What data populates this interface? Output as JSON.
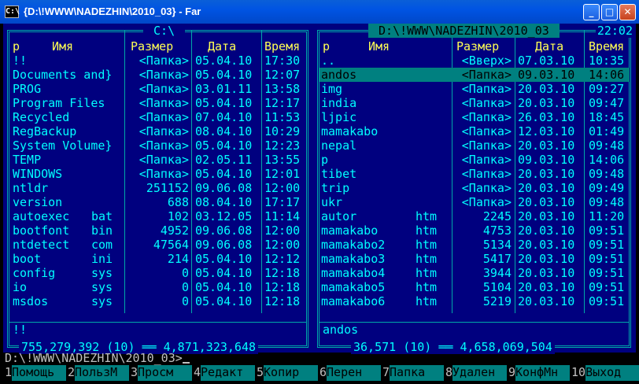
{
  "window": {
    "title": "{D:\\!WWW\\NADEZHIN\\2010_03} - Far",
    "app_icon": "C:\\",
    "buttons": [
      "_",
      "□",
      "✕"
    ]
  },
  "left_panel": {
    "title": " C:\\ ",
    "headers": {
      "p": "p",
      "name": "Имя",
      "size": "Размер",
      "date": "Дата",
      "time": "Время"
    },
    "rows": [
      {
        "name": "!!",
        "ext": "",
        "size": "<Папка>",
        "date": "05.04.10",
        "time": "17:30"
      },
      {
        "name": "Documents and}",
        "ext": "",
        "size": "<Папка>",
        "date": "05.04.10",
        "time": "12:07"
      },
      {
        "name": "PROG",
        "ext": "",
        "size": "<Папка>",
        "date": "03.01.11",
        "time": "13:58"
      },
      {
        "name": "Program Files",
        "ext": "",
        "size": "<Папка>",
        "date": "05.04.10",
        "time": "12:17"
      },
      {
        "name": "Recycled",
        "ext": "",
        "size": "<Папка>",
        "date": "07.04.10",
        "time": "11:53"
      },
      {
        "name": "RegBackup",
        "ext": "",
        "size": "<Папка>",
        "date": "08.04.10",
        "time": "10:29"
      },
      {
        "name": "System Volume}",
        "ext": "",
        "size": "<Папка>",
        "date": "05.04.10",
        "time": "12:23"
      },
      {
        "name": "TEMP",
        "ext": "",
        "size": "<Папка>",
        "date": "02.05.11",
        "time": "13:55"
      },
      {
        "name": "WINDOWS",
        "ext": "",
        "size": "<Папка>",
        "date": "05.04.10",
        "time": "12:01"
      },
      {
        "name": "ntldr",
        "ext": "",
        "size": "251152",
        "date": "09.06.08",
        "time": "12:00"
      },
      {
        "name": "version",
        "ext": "",
        "size": "688",
        "date": "08.04.10",
        "time": "17:17"
      },
      {
        "name": "autoexec",
        "ext": "bat",
        "size": "102",
        "date": "03.12.05",
        "time": "11:14"
      },
      {
        "name": "bootfont",
        "ext": "bin",
        "size": "4952",
        "date": "09.06.08",
        "time": "12:00"
      },
      {
        "name": "ntdetect",
        "ext": "com",
        "size": "47564",
        "date": "09.06.08",
        "time": "12:00"
      },
      {
        "name": "boot",
        "ext": "ini",
        "size": "214",
        "date": "05.04.10",
        "time": "12:12"
      },
      {
        "name": "config",
        "ext": "sys",
        "size": "0",
        "date": "05.04.10",
        "time": "12:18"
      },
      {
        "name": "io",
        "ext": "sys",
        "size": "0",
        "date": "05.04.10",
        "time": "12:18"
      },
      {
        "name": "msdos",
        "ext": "sys",
        "size": "0",
        "date": "05.04.10",
        "time": "12:18"
      }
    ],
    "current_file": "!!",
    "status": "755,279,392 (10) ══ 4,871,323,648"
  },
  "right_panel": {
    "title": " D:\\!WWW\\NADEZHIN\\2010_03 ",
    "clock": "22:02",
    "headers": {
      "p": "p",
      "name": "Имя",
      "size": "Размер",
      "date": "Дата",
      "time": "Время"
    },
    "rows": [
      {
        "name": "..",
        "ext": "",
        "size": "<Вверх>",
        "date": "07.03.10",
        "time": "10:35",
        "selected": false
      },
      {
        "name": "andos",
        "ext": "",
        "size": "<Папка>",
        "date": "09.03.10",
        "time": "14:06",
        "selected": true
      },
      {
        "name": "img",
        "ext": "",
        "size": "<Папка>",
        "date": "20.03.10",
        "time": "09:27",
        "selected": false
      },
      {
        "name": "india",
        "ext": "",
        "size": "<Папка>",
        "date": "20.03.10",
        "time": "09:47",
        "selected": false
      },
      {
        "name": "ljpic",
        "ext": "",
        "size": "<Папка>",
        "date": "26.03.10",
        "time": "18:45",
        "selected": false
      },
      {
        "name": "mamakabo",
        "ext": "",
        "size": "<Папка>",
        "date": "12.03.10",
        "time": "01:49",
        "selected": false
      },
      {
        "name": "nepal",
        "ext": "",
        "size": "<Папка>",
        "date": "20.03.10",
        "time": "09:48",
        "selected": false
      },
      {
        "name": "p",
        "ext": "",
        "size": "<Папка>",
        "date": "09.03.10",
        "time": "14:06",
        "selected": false
      },
      {
        "name": "tibet",
        "ext": "",
        "size": "<Папка>",
        "date": "20.03.10",
        "time": "09:48",
        "selected": false
      },
      {
        "name": "trip",
        "ext": "",
        "size": "<Папка>",
        "date": "20.03.10",
        "time": "09:49",
        "selected": false
      },
      {
        "name": "ukr",
        "ext": "",
        "size": "<Папка>",
        "date": "20.03.10",
        "time": "09:48",
        "selected": false
      },
      {
        "name": "autor",
        "ext": "htm",
        "size": "2245",
        "date": "20.03.10",
        "time": "11:20",
        "selected": false
      },
      {
        "name": "mamakabo",
        "ext": "htm",
        "size": "4753",
        "date": "20.03.10",
        "time": "09:51",
        "selected": false
      },
      {
        "name": "mamakabo2",
        "ext": "htm",
        "size": "5134",
        "date": "20.03.10",
        "time": "09:51",
        "selected": false
      },
      {
        "name": "mamakabo3",
        "ext": "htm",
        "size": "5417",
        "date": "20.03.10",
        "time": "09:51",
        "selected": false
      },
      {
        "name": "mamakabo4",
        "ext": "htm",
        "size": "3944",
        "date": "20.03.10",
        "time": "09:51",
        "selected": false
      },
      {
        "name": "mamakabo5",
        "ext": "htm",
        "size": "5104",
        "date": "20.03.10",
        "time": "09:51",
        "selected": false
      },
      {
        "name": "mamakabo6",
        "ext": "htm",
        "size": "5219",
        "date": "20.03.10",
        "time": "09:51",
        "selected": false
      }
    ],
    "current_file": "andos",
    "status": "36,571 (10) ══ 4,658,069,504"
  },
  "command_line": {
    "prompt": "D:\\!WWW\\NADEZHIN\\2010_03>"
  },
  "keybar": [
    {
      "num": "1",
      "label": "Помощь"
    },
    {
      "num": "2",
      "label": "ПользМ"
    },
    {
      "num": "3",
      "label": "Просм"
    },
    {
      "num": "4",
      "label": "Редакт"
    },
    {
      "num": "5",
      "label": "Копир"
    },
    {
      "num": "6",
      "label": "Перен"
    },
    {
      "num": "7",
      "label": "Папка"
    },
    {
      "num": "8",
      "label": "Удален"
    },
    {
      "num": "9",
      "label": "КонфМн"
    },
    {
      "num": "10",
      "label": "Выход"
    }
  ]
}
